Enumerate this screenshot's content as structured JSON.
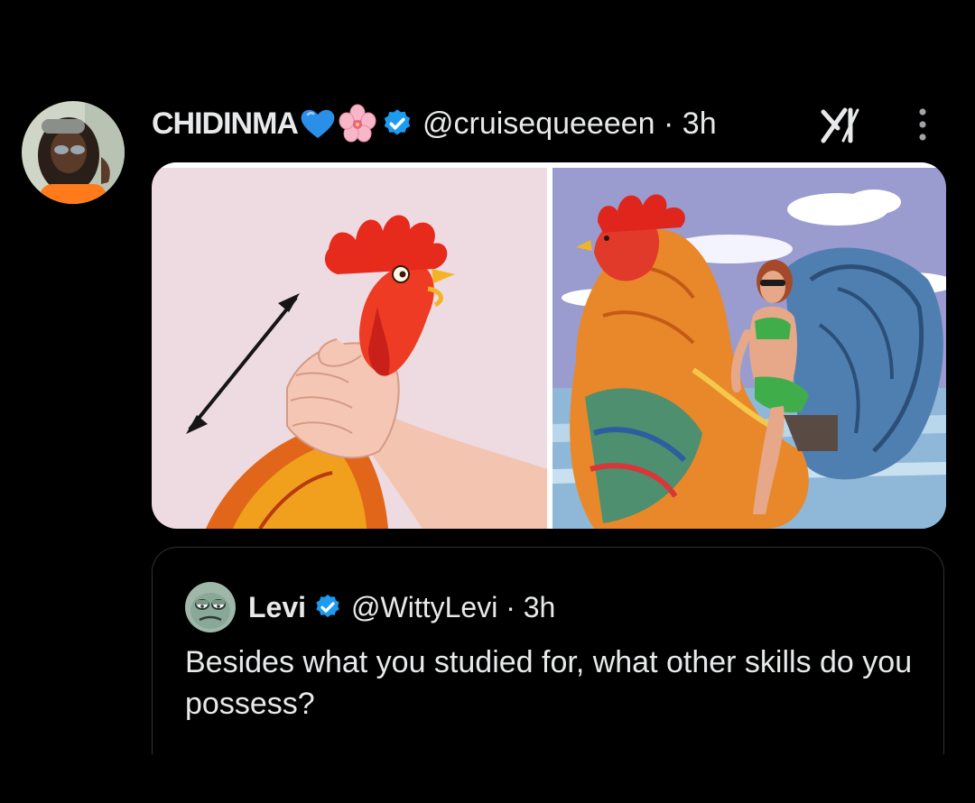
{
  "post": {
    "author": {
      "display_name": "CHIDINMA",
      "name_emojis": [
        "blue-heart-icon",
        "cherry-blossom-icon"
      ],
      "handle": "@cruisequeeeen",
      "separator": "·",
      "timestamp": "3h",
      "verified": true
    },
    "header_icons": [
      "grok-icon",
      "more-vertical-icon"
    ],
    "media": {
      "panels": 2,
      "left_panel": "illustration-hand-holding-rooster-neck",
      "right_panel": "illustration-woman-riding-giant-rooster"
    }
  },
  "quoted_post": {
    "author": {
      "display_name": "Levi",
      "handle": "@WittyLevi",
      "separator": "·",
      "timestamp": "3h",
      "verified": true
    },
    "text": "Besides what you studied for, what other skills do you possess?"
  },
  "colors": {
    "background": "#000000",
    "text": "#e7e9ea",
    "verified_blue": "#1d9bf0",
    "border": "#2f3336"
  }
}
